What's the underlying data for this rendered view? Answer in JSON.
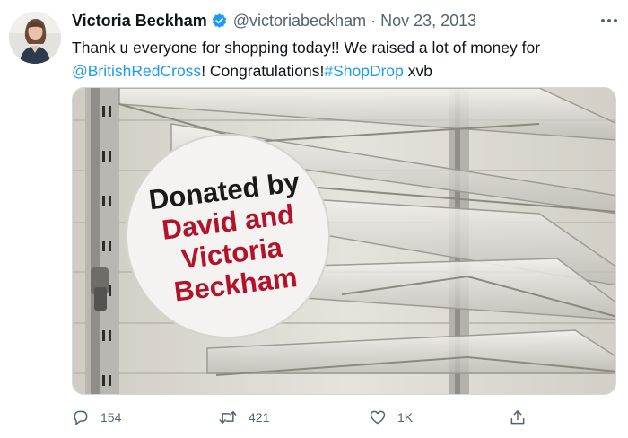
{
  "tweet": {
    "author_name": "Victoria Beckham",
    "handle": "@victoriabeckham",
    "separator": "·",
    "date": "Nov 23, 2013",
    "text_part1": "Thank u everyone for shopping today!! We raised a lot of money for ",
    "mention": "@BritishRedCross",
    "text_part2": "! Congratulations!",
    "hashtag": "#ShopDrop",
    "text_part3": " xvb",
    "verified": true
  },
  "media": {
    "sign_line1": "Donated by",
    "sign_line2": "David and",
    "sign_line3": "Victoria",
    "sign_line4": "Beckham"
  },
  "actions": {
    "reply_count": "154",
    "retweet_count": "421",
    "like_count": "1K"
  },
  "colors": {
    "link": "#1d9bf0",
    "muted": "#536471",
    "verified_badge": "#1d9bf0",
    "sign_text_dark": "#1a1a1a",
    "sign_text_red": "#b3122a"
  },
  "icons": {
    "reply": "reply-icon",
    "retweet": "retweet-icon",
    "like": "heart-icon",
    "share": "share-icon",
    "more": "more-icon",
    "verified": "verified-badge-icon"
  }
}
